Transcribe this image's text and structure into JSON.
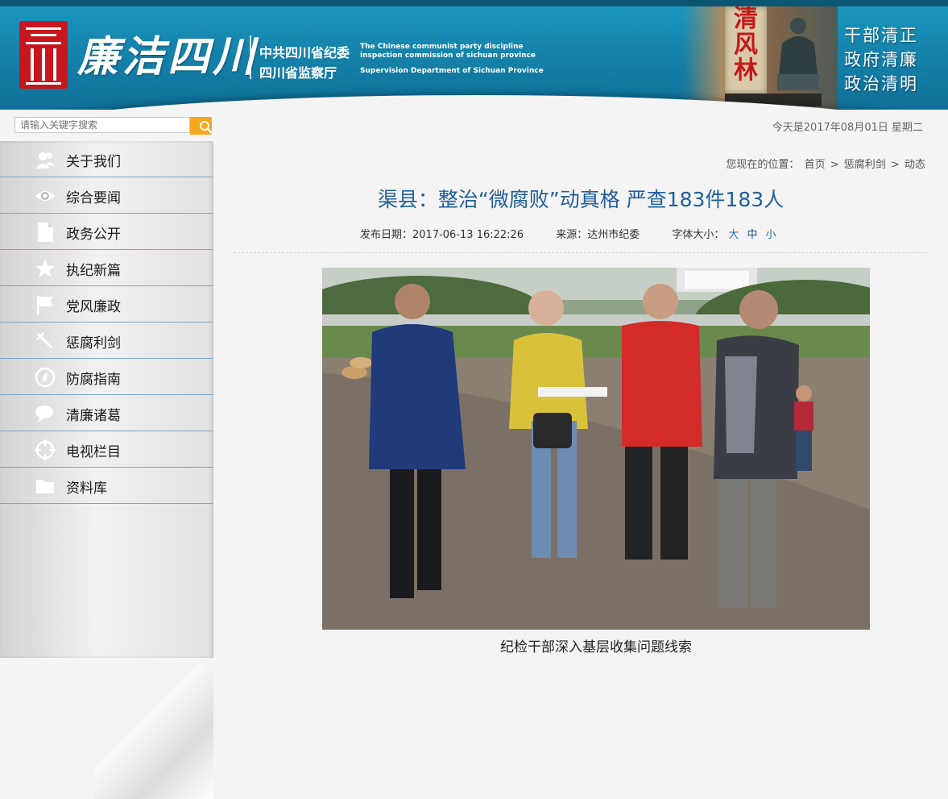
{
  "header": {
    "logo_text": "廉洁四川",
    "org_cn_1": "中共四川省纪委",
    "org_cn_2": "四川省监察厅",
    "org_en_1": "The Chinese communist party discipline",
    "org_en_2": "inspection commission of sichuan province",
    "org_en_3": "Supervision Department of Sichuan Province",
    "stele_text": [
      "清",
      "风",
      "林"
    ],
    "slogans": [
      "干部清正",
      "政府清廉",
      "政治清明"
    ],
    "accent_color": "#1686ae"
  },
  "search": {
    "placeholder": "请输入关键字搜索",
    "button_icon": "search-icon",
    "button_color": "#f3a91b"
  },
  "date_text": "今天是2017年08月01日 星期二",
  "sidebar": {
    "items": [
      {
        "label": "关于我们",
        "icon": "people-icon"
      },
      {
        "label": "综合要闻",
        "icon": "eye-icon"
      },
      {
        "label": "政务公开",
        "icon": "document-icon"
      },
      {
        "label": "执纪新篇",
        "icon": "star-icon"
      },
      {
        "label": "党风廉政",
        "icon": "flag-icon"
      },
      {
        "label": "惩腐利剑",
        "icon": "sword-icon"
      },
      {
        "label": "防腐指南",
        "icon": "compass-icon"
      },
      {
        "label": "清廉诸葛",
        "icon": "chat-icon"
      },
      {
        "label": "电视栏目",
        "icon": "target-icon"
      },
      {
        "label": "资料库",
        "icon": "folder-icon"
      }
    ]
  },
  "breadcrumb": {
    "prefix": "您现在的位置：",
    "items": [
      "首页",
      "惩腐利剑",
      "动态"
    ],
    "separator": ">"
  },
  "article": {
    "title": "渠县：整治“微腐败”动真格 严查183件183人",
    "publish_label": "发布日期：",
    "publish_date": "2017-06-13 16:22:26",
    "source_label": "来源：",
    "source": "达州市纪委",
    "font_size_label": "字体大小：",
    "font_sizes": [
      "大",
      "中",
      "小"
    ],
    "caption": "纪检干部深入基层收集问题线索"
  }
}
